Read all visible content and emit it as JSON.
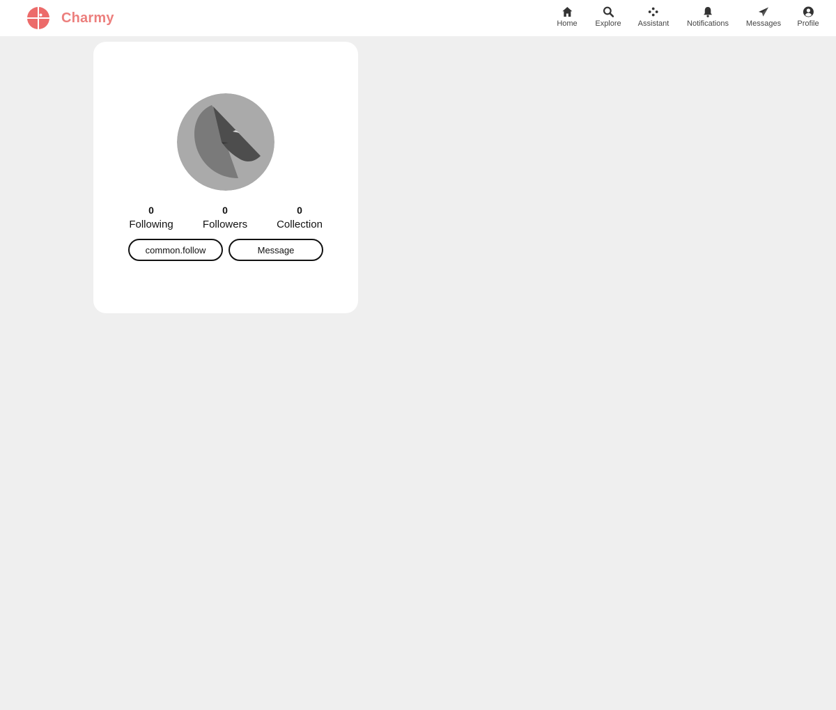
{
  "app": {
    "name": "Charmy",
    "brand_color": "#ec7f7d"
  },
  "nav": {
    "items": [
      {
        "label": "Home",
        "icon": "home-icon"
      },
      {
        "label": "Explore",
        "icon": "search-icon"
      },
      {
        "label": "Assistant",
        "icon": "assistant-icon"
      },
      {
        "label": "Notifications",
        "icon": "bell-icon"
      },
      {
        "label": "Messages",
        "icon": "paper-plane-icon"
      },
      {
        "label": "Profile",
        "icon": "user-circle-icon"
      }
    ]
  },
  "profile": {
    "avatar_icon": "avatar-placeholder",
    "stats": [
      {
        "value": "0",
        "label": "Following"
      },
      {
        "value": "0",
        "label": "Followers"
      },
      {
        "value": "0",
        "label": "Collection"
      }
    ],
    "follow_label": "common.follow",
    "message_label": "Message"
  }
}
